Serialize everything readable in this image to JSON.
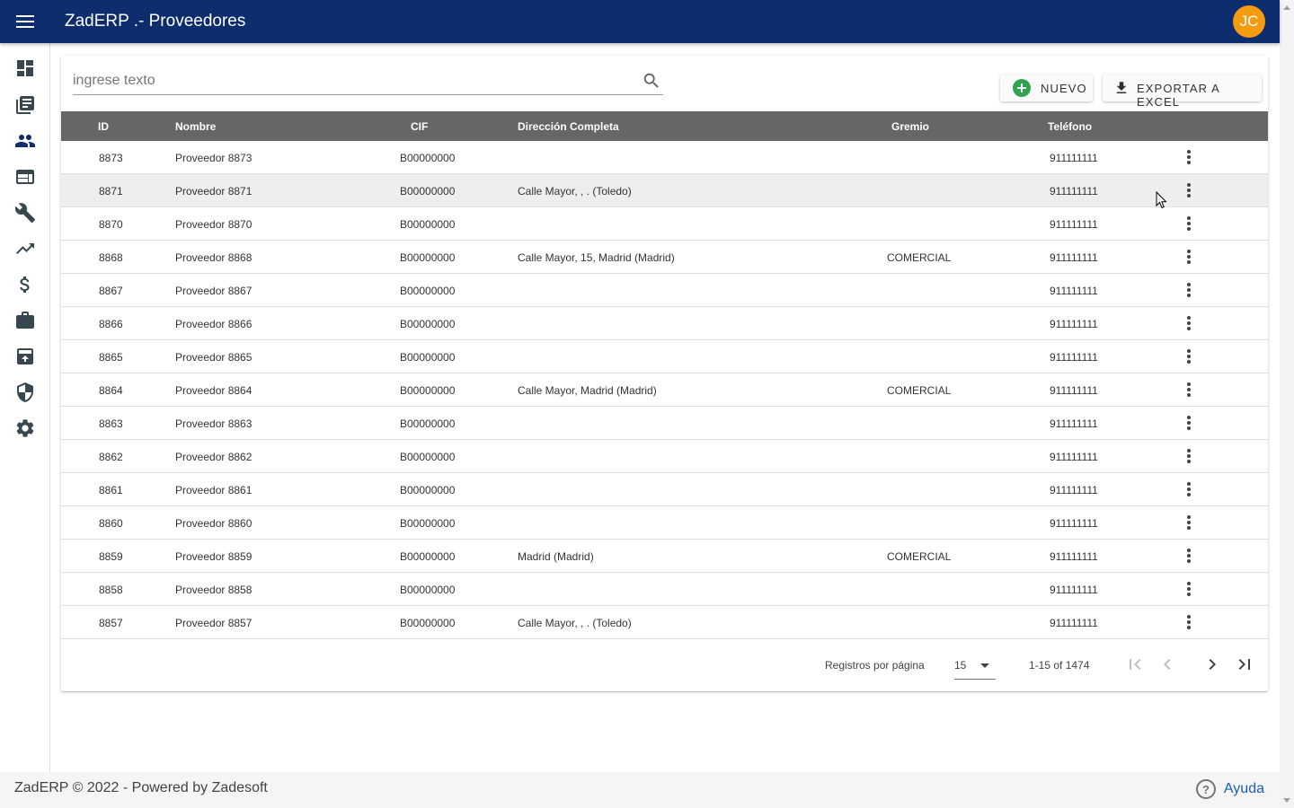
{
  "app": {
    "title": "ZadERP .- Proveedores",
    "user_initials": "JC"
  },
  "sidebar": {
    "items": [
      {
        "icon": "dashboard-icon"
      },
      {
        "icon": "library-books-icon"
      },
      {
        "icon": "people-icon"
      },
      {
        "icon": "web-icon"
      },
      {
        "icon": "wrench-icon"
      },
      {
        "icon": "trending-up-icon"
      },
      {
        "icon": "dollar-icon"
      },
      {
        "icon": "briefcase-icon"
      },
      {
        "icon": "archive-icon"
      },
      {
        "icon": "shield-icon"
      },
      {
        "icon": "gear-icon"
      }
    ]
  },
  "search": {
    "placeholder": "ingrese texto",
    "value": ""
  },
  "toolbar": {
    "new_label": "NUEVO",
    "export_label": "EXPORTAR A EXCEL"
  },
  "table": {
    "columns": [
      "ID",
      "Nombre",
      "CIF",
      "Dirección Completa",
      "Gremio",
      "Teléfono"
    ],
    "rows": [
      {
        "id": "8873",
        "nombre": "Proveedor 8873",
        "cif": "B00000000",
        "direccion": "",
        "gremio": "",
        "telefono": "911111111"
      },
      {
        "id": "8871",
        "nombre": "Proveedor 8871",
        "cif": "B00000000",
        "direccion": "Calle Mayor, , . (Toledo)",
        "gremio": "",
        "telefono": "911111111"
      },
      {
        "id": "8870",
        "nombre": "Proveedor 8870",
        "cif": "B00000000",
        "direccion": "",
        "gremio": "",
        "telefono": "911111111"
      },
      {
        "id": "8868",
        "nombre": "Proveedor 8868",
        "cif": "B00000000",
        "direccion": "Calle Mayor, 15, Madrid (Madrid)",
        "gremio": "COMERCIAL",
        "telefono": "911111111"
      },
      {
        "id": "8867",
        "nombre": "Proveedor 8867",
        "cif": "B00000000",
        "direccion": "",
        "gremio": "",
        "telefono": "911111111"
      },
      {
        "id": "8866",
        "nombre": "Proveedor 8866",
        "cif": "B00000000",
        "direccion": "",
        "gremio": "",
        "telefono": "911111111"
      },
      {
        "id": "8865",
        "nombre": "Proveedor 8865",
        "cif": "B00000000",
        "direccion": "",
        "gremio": "",
        "telefono": "911111111"
      },
      {
        "id": "8864",
        "nombre": "Proveedor 8864",
        "cif": "B00000000",
        "direccion": "Calle Mayor, Madrid (Madrid)",
        "gremio": "COMERCIAL",
        "telefono": "911111111"
      },
      {
        "id": "8863",
        "nombre": "Proveedor 8863",
        "cif": "B00000000",
        "direccion": "",
        "gremio": "",
        "telefono": "911111111"
      },
      {
        "id": "8862",
        "nombre": "Proveedor 8862",
        "cif": "B00000000",
        "direccion": "",
        "gremio": "",
        "telefono": "911111111"
      },
      {
        "id": "8861",
        "nombre": "Proveedor 8861",
        "cif": "B00000000",
        "direccion": "",
        "gremio": "",
        "telefono": "911111111"
      },
      {
        "id": "8860",
        "nombre": "Proveedor 8860",
        "cif": "B00000000",
        "direccion": "",
        "gremio": "",
        "telefono": "911111111"
      },
      {
        "id": "8859",
        "nombre": "Proveedor 8859",
        "cif": "B00000000",
        "direccion": "Madrid (Madrid)",
        "gremio": "COMERCIAL",
        "telefono": "911111111"
      },
      {
        "id": "8858",
        "nombre": "Proveedor 8858",
        "cif": "B00000000",
        "direccion": "",
        "gremio": "",
        "telefono": "911111111"
      },
      {
        "id": "8857",
        "nombre": "Proveedor 8857",
        "cif": "B00000000",
        "direccion": "Calle Mayor, , . (Toledo)",
        "gremio": "",
        "telefono": "911111111"
      }
    ]
  },
  "pagination": {
    "label": "Registros por página",
    "page_size": "15",
    "range": "1-15 of 1474"
  },
  "footer": {
    "text": "ZadERP © 2022 - Powered by Zadesoft",
    "help_label": "Ayuda"
  },
  "colors": {
    "header_bg": "#0d2d6e",
    "avatar_bg": "#f39c12",
    "table_header_bg": "#666666",
    "new_icon": "#2ea44f",
    "help_link": "#1a5fb4"
  }
}
